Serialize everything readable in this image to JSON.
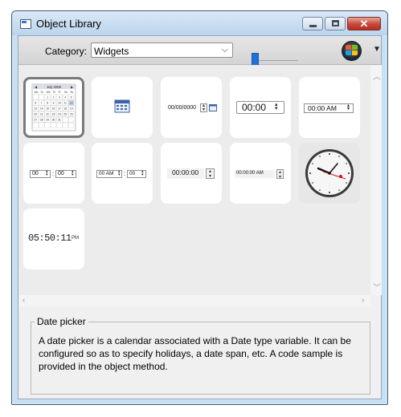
{
  "window": {
    "title": "Object Library"
  },
  "toolbar": {
    "category_label": "Category:",
    "category_value": "Widgets",
    "slider_level": 0.0
  },
  "widgets": [
    {
      "name": "Date picker calendar",
      "month_label": "July 2009",
      "selected": true
    },
    {
      "name": "Calendar icon button"
    },
    {
      "name": "Date entry",
      "value": "00/00/0000"
    },
    {
      "name": "Time entry",
      "value": "00:00"
    },
    {
      "name": "Time entry AM/PM",
      "value": "00:00 AM"
    },
    {
      "name": "Hour minute steppers",
      "hours": "00",
      "minutes": "00"
    },
    {
      "name": "AM selectors",
      "value1": "00 AM",
      "value2": "00"
    },
    {
      "name": "Time seconds",
      "value": "00:00:00"
    },
    {
      "name": "Time seconds AM",
      "value": "00:00:00 AM"
    },
    {
      "name": "Analog clock"
    },
    {
      "name": "Digital clock",
      "time": "05:50:11",
      "suffix": "PM"
    }
  ],
  "calendar": {
    "nav_prev": "◀",
    "nav_next": "▶",
    "weekdays": [
      "Mo",
      "Tu",
      "We",
      "Th",
      "Fr",
      "Sa",
      "Su"
    ]
  },
  "description": {
    "title": "Date picker",
    "text": "A date picker is a calendar associated with a Date type variable. It can be configured so as to specify holidays, a date span, etc. A code sample is provided in the object method."
  },
  "colors": {
    "titlebar": "#c9dff2",
    "close_button": "#c7473a",
    "slider": "#1f72d6"
  }
}
